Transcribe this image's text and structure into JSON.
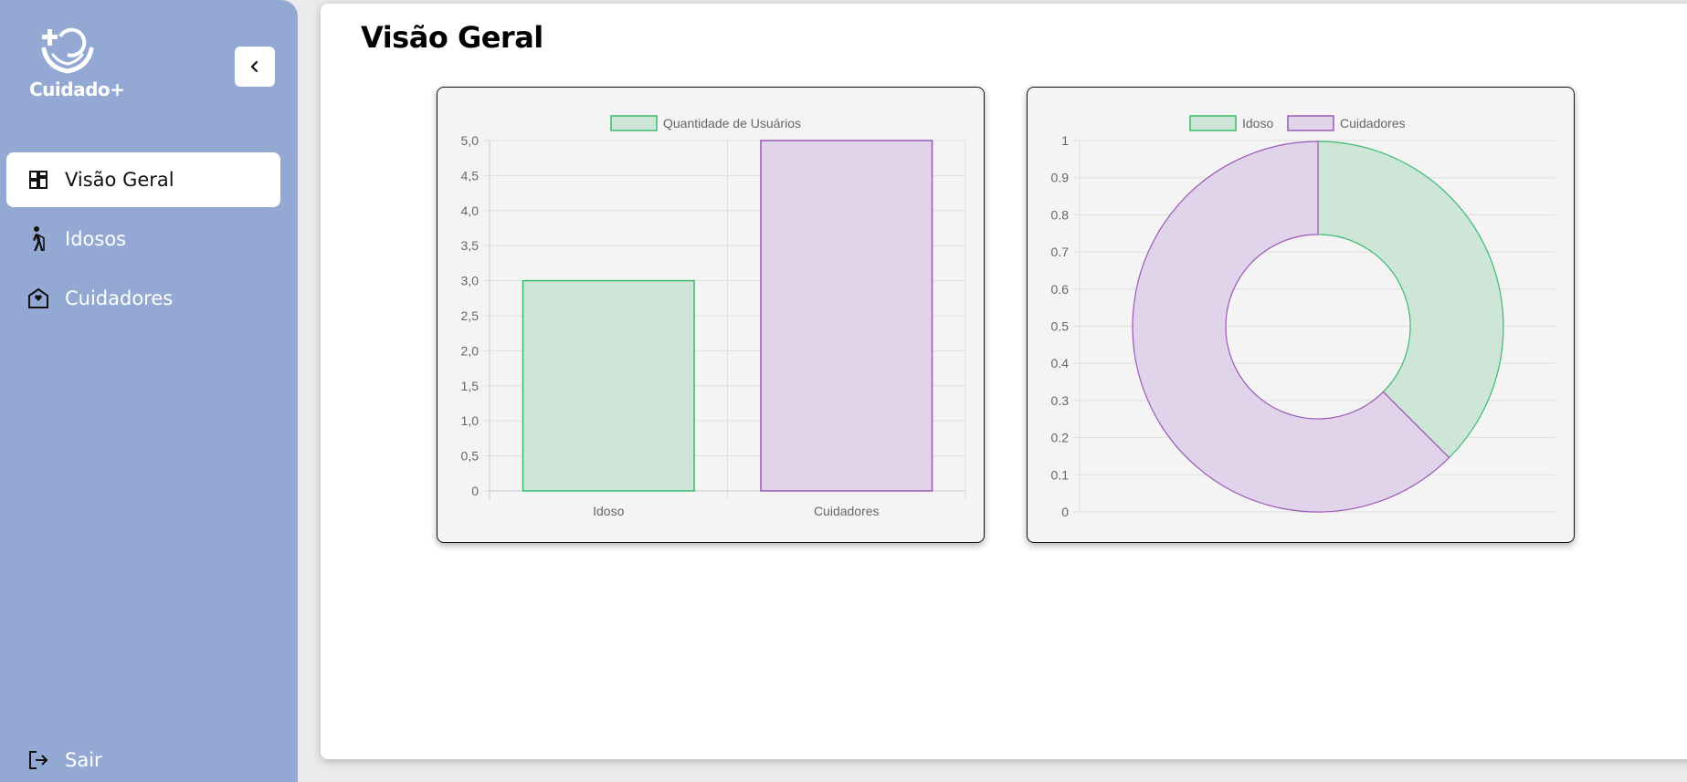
{
  "app": {
    "brand": "Cuidado+"
  },
  "sidebar": {
    "items": [
      {
        "label": "Visão Geral",
        "icon": "dashboard-icon",
        "active": true
      },
      {
        "label": "Idosos",
        "icon": "elderly-icon",
        "active": false
      },
      {
        "label": "Cuidadores",
        "icon": "home-health-icon",
        "active": false
      }
    ],
    "logout_label": "Sair"
  },
  "main": {
    "title": "Visão Geral"
  },
  "colors": {
    "sidebar_bg": "#93a9d4",
    "idoso_fill": "#cde6d7",
    "idoso_border": "#3cba6d",
    "cuidadores_fill": "#e1d3e9",
    "cuidadores_border": "#9b59b6"
  },
  "chart_data": [
    {
      "type": "bar",
      "legend": [
        "Quantidade de Usuários"
      ],
      "categories": [
        "Idoso",
        "Cuidadores"
      ],
      "series": [
        {
          "name": "Quantidade de Usuários",
          "values": [
            3,
            5
          ]
        }
      ],
      "ylim": [
        0,
        5
      ],
      "yticks": [
        "0",
        "0,5",
        "1,0",
        "1,5",
        "2,0",
        "2,5",
        "3,0",
        "3,5",
        "4,0",
        "4,5",
        "5,0"
      ],
      "grid": true,
      "legend_position": "top"
    },
    {
      "type": "pie",
      "variant": "doughnut",
      "legend": [
        "Idoso",
        "Cuidadores"
      ],
      "labels": [
        "Idoso",
        "Cuidadores"
      ],
      "values": [
        3,
        5
      ],
      "yticks": [
        "0",
        "0.1",
        "0.2",
        "0.3",
        "0.4",
        "0.5",
        "0.6",
        "0.7",
        "0.8",
        "0.9",
        "1"
      ],
      "grid": true,
      "legend_position": "top"
    }
  ]
}
